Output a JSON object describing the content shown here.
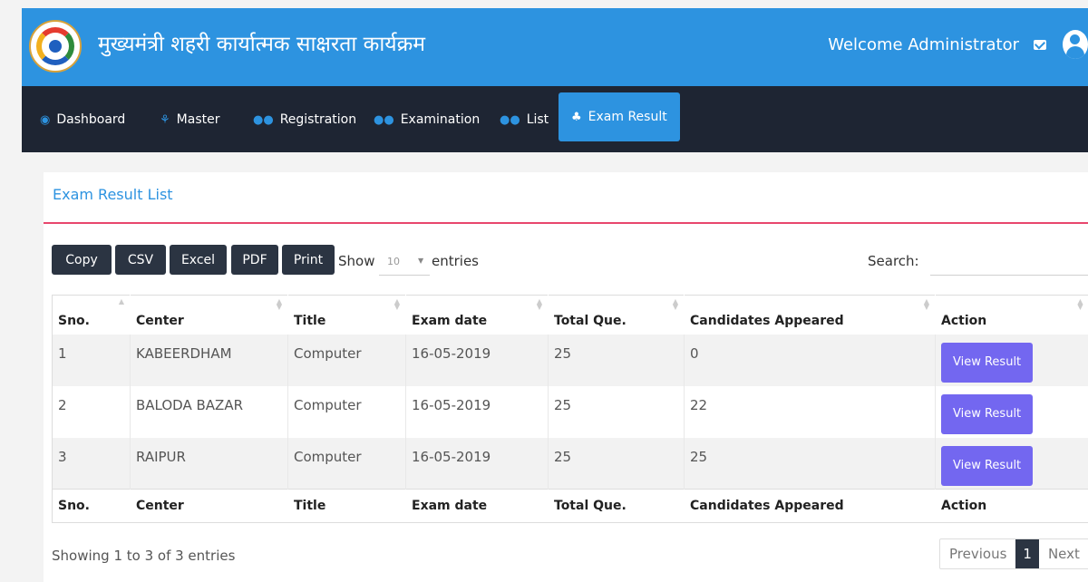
{
  "header": {
    "app_title": "मुख्यमंत्री शहरी कार्यात्मक साक्षरता कार्यक्रम",
    "welcome_text": "Welcome Administrator",
    "logo_icon": "program-seal-logo",
    "mail_icon": "envelope-icon",
    "user_icon": "user-circle-icon",
    "colors": {
      "topbar": "#2d93e0",
      "navbar": "#1e2533",
      "accent_line": "#e8476d",
      "view_button": "#7367f0"
    }
  },
  "nav": {
    "items": [
      {
        "label": "Dashboard",
        "icon": "dashboard-icon"
      },
      {
        "label": "Master",
        "icon": "sitemap-icon"
      },
      {
        "label": "Registration",
        "icon": "users-icon"
      },
      {
        "label": "Examination",
        "icon": "users-icon"
      },
      {
        "label": "List",
        "icon": "users-icon"
      },
      {
        "label": "Exam Result",
        "icon": "user-secret-icon",
        "active": true
      }
    ]
  },
  "card": {
    "title": "Exam Result List"
  },
  "toolbar": {
    "buttons": [
      "Copy",
      "CSV",
      "Excel",
      "PDF",
      "Print"
    ],
    "show_label": "Show",
    "page_length": "10",
    "entries_label": "entries",
    "search_label": "Search:",
    "search_value": ""
  },
  "table": {
    "columns": [
      "Sno.",
      "Center",
      "Title",
      "Exam date",
      "Total Que.",
      "Candidates Appeared",
      "Action"
    ],
    "rows": [
      {
        "sno": "1",
        "center": "KABEERDHAM",
        "title": "Computer",
        "exam_date": "16-05-2019",
        "total_que": "25",
        "candidates": "0",
        "action": "View Result"
      },
      {
        "sno": "2",
        "center": "BALODA BAZAR",
        "title": "Computer",
        "exam_date": "16-05-2019",
        "total_que": "25",
        "candidates": "22",
        "action": "View Result"
      },
      {
        "sno": "3",
        "center": "RAIPUR",
        "title": "Computer",
        "exam_date": "16-05-2019",
        "total_que": "25",
        "candidates": "25",
        "action": "View Result"
      }
    ]
  },
  "footer": {
    "info": "Showing 1 to 3 of 3 entries",
    "previous": "Previous",
    "current_page": "1",
    "next": "Next"
  }
}
